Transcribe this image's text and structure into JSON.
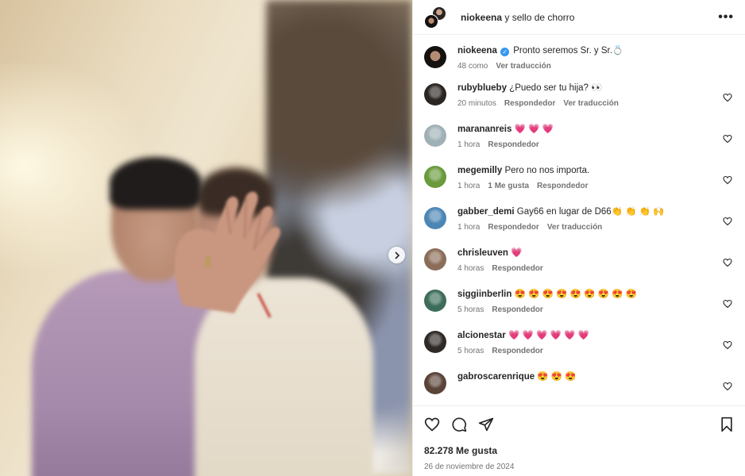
{
  "header": {
    "username": "niokeena",
    "connector": " y ",
    "collaborator": "sello de chorro",
    "more_label": "•••"
  },
  "caption": {
    "username": "niokeena",
    "text": "Pronto seremos Sr. y Sr.💍",
    "time": "48 como",
    "translate": "Ver traducción"
  },
  "comments": [
    {
      "user": "rubyblueby",
      "text": "¿Puedo ser tu hija? 👀",
      "time": "20 minutos",
      "likes": "",
      "reply": "Respondedor",
      "translate": "Ver traducción",
      "avatar": "#2b2522"
    },
    {
      "user": "marananreis",
      "text": "💗 💗 💗",
      "time": "1 hora",
      "likes": "",
      "reply": "Respondedor",
      "translate": "",
      "avatar": "#9fb0b6"
    },
    {
      "user": "megemilly",
      "text": "Pero no nos importa.",
      "time": "1 hora",
      "likes": "1 Me gusta",
      "reply": "Respondedor",
      "translate": "",
      "avatar": "#6a9a3c"
    },
    {
      "user": "gabber_demi",
      "text": "Gay66 en lugar de D66👏 👏 👏 🙌",
      "time": "1 hora",
      "likes": "",
      "reply": "Respondedor",
      "translate": "Ver traducción",
      "avatar": "#4c86b5"
    },
    {
      "user": "chrisleuven",
      "text": "💗",
      "time": "4 horas",
      "likes": "",
      "reply": "Respondedor",
      "translate": "",
      "avatar": "#8b6d58"
    },
    {
      "user": "siggiinberlin",
      "text": "😍 😍 😍 😍 😍 😍 😍 😍 😍",
      "time": "5 horas",
      "likes": "",
      "reply": "Respondedor",
      "translate": "",
      "avatar": "#3d6d5a"
    },
    {
      "user": "alcionestar",
      "text": "💗 💗 💗 💗 💗 💗",
      "time": "5 horas",
      "likes": "",
      "reply": "Respondedor",
      "translate": "",
      "avatar": "#2f2a27"
    },
    {
      "user": "gabroscarenrique",
      "text": "😍 😍 😍",
      "time": "",
      "likes": "",
      "reply": "",
      "translate": "",
      "avatar": "#5a4338"
    }
  ],
  "likes_count": "82.278 Me gusta",
  "date": "26 de noviembre de 2024",
  "icons": {
    "like": "heart-icon",
    "comment": "comment-icon",
    "share": "share-icon",
    "save": "bookmark-icon",
    "next": "chevron-right-icon",
    "more": "more-icon"
  },
  "colors": {
    "text": "#262626",
    "muted": "#737373",
    "verified": "#3897f0",
    "divider": "#efefef"
  }
}
